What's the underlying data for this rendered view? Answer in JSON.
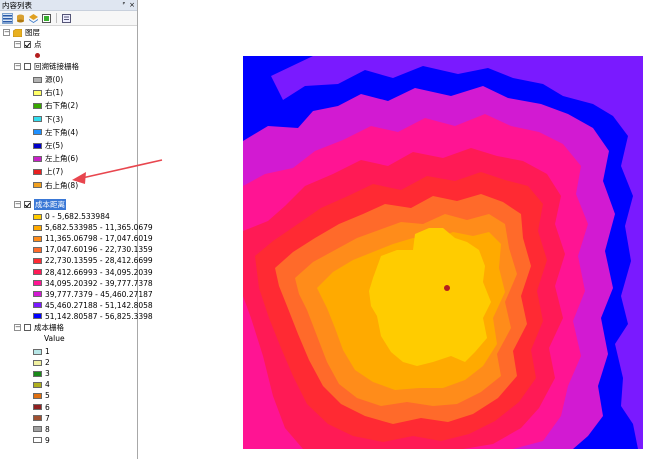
{
  "toc": {
    "title": "内容列表",
    "pin_glyph": "ᴾ",
    "close_glyph": "×"
  },
  "layers": {
    "root_label": "图层",
    "point_layer": {
      "label": "点"
    },
    "backlink_layer": {
      "label": "回溯链接栅格",
      "items": [
        {
          "label": "源(0)",
          "color": "#b2b2b2"
        },
        {
          "label": "右(1)",
          "color": "#ffff66"
        },
        {
          "label": "右下角(2)",
          "color": "#38a800"
        },
        {
          "label": "下(3)",
          "color": "#33ddee"
        },
        {
          "label": "左下角(4)",
          "color": "#1e90ff"
        },
        {
          "label": "左(5)",
          "color": "#0000c8"
        },
        {
          "label": "左上角(6)",
          "color": "#c820c8"
        },
        {
          "label": "上(7)",
          "color": "#e82020"
        },
        {
          "label": "右上角(8)",
          "color": "#f0a020"
        }
      ]
    },
    "cost_distance_layer": {
      "label": "成本距离",
      "items": [
        {
          "label": "0 - 5,682.533984",
          "color": "#ffcc00"
        },
        {
          "label": "5,682.533985 - 11,365.0679",
          "color": "#ffaa00"
        },
        {
          "label": "11,365.06798 - 17,047.6019",
          "color": "#ff8c1a"
        },
        {
          "label": "17,047.60196 - 22,730.1359",
          "color": "#ff6a2a"
        },
        {
          "label": "22,730.13595 - 28,412.6699",
          "color": "#ff2a33"
        },
        {
          "label": "28,412.66993 - 34,095.2039",
          "color": "#ff1a55"
        },
        {
          "label": "34,095.20392 - 39,777.7378",
          "color": "#ff1493"
        },
        {
          "label": "39,777.7379 - 45,460.27187",
          "color": "#d21ad2"
        },
        {
          "label": "45,460.27188 - 51,142.8058",
          "color": "#7a1aff"
        },
        {
          "label": "51,142.80587 - 56,825.3398",
          "color": "#0000ff"
        }
      ]
    },
    "cost_raster_layer": {
      "label": "成本栅格",
      "field": "Value",
      "items": [
        {
          "label": "1",
          "color": "#b7e6e6"
        },
        {
          "label": "2",
          "color": "#f0f0a0"
        },
        {
          "label": "3",
          "color": "#1a8a1a"
        },
        {
          "label": "4",
          "color": "#b0b020"
        },
        {
          "label": "5",
          "color": "#e07010"
        },
        {
          "label": "6",
          "color": "#902020"
        },
        {
          "label": "7",
          "color": "#a05030"
        },
        {
          "label": "8",
          "color": "#a0a0a0"
        },
        {
          "label": "9",
          "color": "#ffffff"
        }
      ]
    }
  },
  "map": {
    "zone_colors": [
      "#0000ff",
      "#7a1aff",
      "#d21ad2",
      "#ff1493",
      "#ff1a55",
      "#ff2a33",
      "#ff6a2a",
      "#ff8c1a",
      "#ffaa00",
      "#ffcc00"
    ],
    "source_point_color": "#b41e1e",
    "annotation_arrow_color": "#e8464e"
  }
}
